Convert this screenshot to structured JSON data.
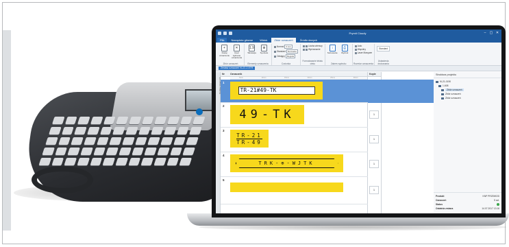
{
  "app": {
    "title": "Prymit Cloudy",
    "quick_access": [
      "save",
      "undo",
      "redo"
    ],
    "window_controls": [
      "–",
      "▢",
      "✕"
    ]
  },
  "tabs": [
    {
      "label": "Plik",
      "active": false
    },
    {
      "label": "Narzędzia główne",
      "active": false
    },
    {
      "label": "Widok",
      "active": false
    },
    {
      "label": "Zbiór oznaczeń",
      "active": true
    },
    {
      "label": "Źródło danych",
      "active": false
    }
  ],
  "ribbon": {
    "groups": [
      {
        "label": "Zbiór oznaczeń",
        "buttons": [
          {
            "label": "Dodaj oznaczenie",
            "icon": "add-doc-icon"
          },
          {
            "label": "Usuń wybrane oznaczenia",
            "icon": "trash-icon"
          }
        ]
      },
      {
        "label": "Elementy oznaczenia",
        "buttons": [
          {
            "label": "Tabulacja",
            "icon": "tabulation-icon",
            "glyph": "1.9"
          },
          {
            "label": "Symbole",
            "icon": "symbols-icon",
            "glyph": "⊕"
          }
        ]
      },
      {
        "label": "Czcionka",
        "items": [
          {
            "label": "Normal",
            "value": "3 mm"
          },
          {
            "label": "Standard",
            "value": "Normalne"
          },
          {
            "label": "Odstępy",
            "value": "Regular"
          }
        ]
      },
      {
        "label": "Formatowanie tekstu cieku",
        "items": [
          {
            "label": "Liczba wierszy"
          },
          {
            "label": "Wyrównanie"
          }
        ]
      },
      {
        "label": "Zakres wydruku",
        "buttons": [
          {
            "label": "Sortowanie",
            "icon": "sort-icon"
          },
          {
            "label": "Wydruk",
            "icon": "print-icon"
          }
        ]
      },
      {
        "label": "Rozmiar oznaczenia",
        "items": [
          {
            "label": "Auto"
          },
          {
            "label": "Wspólny"
          },
          {
            "label": "Laser Marquee"
          }
        ]
      },
      {
        "label": "Ustawienia drukowania",
        "items": [
          {
            "label": "Standard"
          }
        ]
      }
    ]
  },
  "breadcrumb": {
    "label": "Zestaw oznaczeń KLZ1.2-5TR"
  },
  "side_tab": {
    "label": "Zestaw oznaczeń"
  },
  "grid": {
    "col_number": "Nr",
    "col_marker": "Oznacznik",
    "col_copies": "Kopie",
    "ruler": [
      "5mm",
      "10mm",
      "15mm",
      "20mm",
      "25mm",
      "30mm"
    ],
    "rows": [
      {
        "num": "1",
        "type": "input",
        "text": "TR-21#49-TK",
        "copies": "1",
        "selected": true
      },
      {
        "num": "2",
        "type": "big",
        "text": "49-TK",
        "copies": "1"
      },
      {
        "num": "3",
        "type": "stack",
        "lines": [
          "TR-21",
          "TR-49"
        ],
        "copies": "1"
      },
      {
        "num": "4",
        "type": "hex",
        "text": "TRK-⊕-WJTK",
        "copies": "1"
      },
      {
        "num": "5",
        "type": "partial",
        "text": "",
        "copies": "1"
      }
    ]
  },
  "project_tree": {
    "title": "Struktura projektu",
    "items": [
      {
        "label": "KL21-0190",
        "level": 0
      },
      {
        "label": "1-608",
        "level": 1
      },
      {
        "label": "Zbiór oznaczeń",
        "level": 2,
        "selected": true
      },
      {
        "label": "Zbiór oznaczeń",
        "level": 2
      },
      {
        "label": "Zbiór oznaczeń",
        "level": 2
      }
    ]
  },
  "properties": [
    {
      "label": "Produkt",
      "value": "KNP PRZEWOD"
    },
    {
      "label": "Oznaczeń",
      "value": "5 szt."
    },
    {
      "label": "Status",
      "value": "OK"
    },
    {
      "label": "Ostatnia zmiana",
      "value": "14.07.2017 13:16"
    }
  ],
  "colors": {
    "ribbon_blue": "#1f5b9f",
    "marker_yellow": "#f7d81c",
    "selection_blue": "#5b92d6"
  }
}
